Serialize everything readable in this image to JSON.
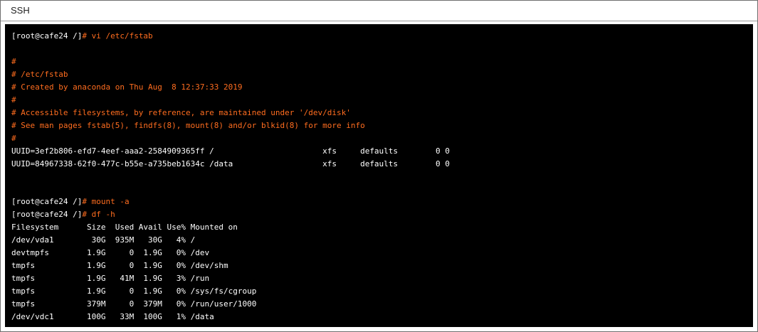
{
  "window": {
    "title": "SSH"
  },
  "colors": {
    "terminal_background": "#000000",
    "text": "#ffffff",
    "highlight": "#ff6d1f",
    "frame_border": "#6e6e6e"
  },
  "terminal": {
    "lines": [
      {
        "prompt": "[root@cafe24 /]",
        "command": "# vi /etc/fstab"
      },
      {
        "text": "#",
        "kind": "comment"
      },
      {
        "text": "# /etc/fstab",
        "kind": "comment"
      },
      {
        "text": "# Created by anaconda on Thu Aug  8 12:37:33 2019",
        "kind": "comment"
      },
      {
        "text": "#",
        "kind": "comment"
      },
      {
        "text": "# Accessible filesystems, by reference, are maintained under '/dev/disk'",
        "kind": "comment"
      },
      {
        "text": "# See man pages fstab(5), findfs(8), mount(8) and/or blkid(8) for more info",
        "kind": "comment"
      },
      {
        "text": "#",
        "kind": "comment"
      },
      {
        "text": "UUID=3ef2b806-efd7-4eef-aaa2-2584909365ff /                       xfs     defaults        0 0",
        "kind": "output"
      },
      {
        "text": "UUID=84967338-62f0-477c-b55e-a735beb1634c /data                   xfs     defaults        0 0",
        "kind": "output"
      },
      {
        "prompt": "[root@cafe24 /]",
        "command": "# mount -a"
      },
      {
        "prompt": "[root@cafe24 /]",
        "command": "# df -h"
      },
      {
        "text": "Filesystem      Size  Used Avail Use% Mounted on",
        "kind": "output"
      },
      {
        "text": "/dev/vda1        30G  935M   30G   4% /",
        "kind": "output"
      },
      {
        "text": "devtmpfs        1.9G     0  1.9G   0% /dev",
        "kind": "output"
      },
      {
        "text": "tmpfs           1.9G     0  1.9G   0% /dev/shm",
        "kind": "output"
      },
      {
        "text": "tmpfs           1.9G   41M  1.9G   3% /run",
        "kind": "output"
      },
      {
        "text": "tmpfs           1.9G     0  1.9G   0% /sys/fs/cgroup",
        "kind": "output"
      },
      {
        "text": "tmpfs           379M     0  379M   0% /run/user/1000",
        "kind": "output"
      },
      {
        "text": "/dev/vdc1       100G   33M  100G   1% /data",
        "kind": "output"
      }
    ]
  }
}
